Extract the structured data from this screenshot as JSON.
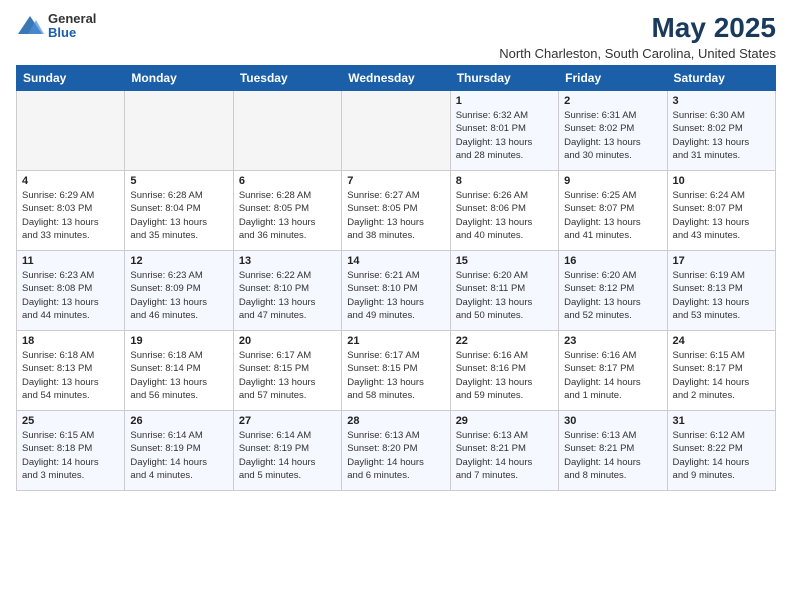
{
  "logo": {
    "general": "General",
    "blue": "Blue"
  },
  "header": {
    "title": "May 2025",
    "location": "North Charleston, South Carolina, United States"
  },
  "weekdays": [
    "Sunday",
    "Monday",
    "Tuesday",
    "Wednesday",
    "Thursday",
    "Friday",
    "Saturday"
  ],
  "weeks": [
    [
      {
        "day": "",
        "info": ""
      },
      {
        "day": "",
        "info": ""
      },
      {
        "day": "",
        "info": ""
      },
      {
        "day": "",
        "info": ""
      },
      {
        "day": "1",
        "info": "Sunrise: 6:32 AM\nSunset: 8:01 PM\nDaylight: 13 hours\nand 28 minutes."
      },
      {
        "day": "2",
        "info": "Sunrise: 6:31 AM\nSunset: 8:02 PM\nDaylight: 13 hours\nand 30 minutes."
      },
      {
        "day": "3",
        "info": "Sunrise: 6:30 AM\nSunset: 8:02 PM\nDaylight: 13 hours\nand 31 minutes."
      }
    ],
    [
      {
        "day": "4",
        "info": "Sunrise: 6:29 AM\nSunset: 8:03 PM\nDaylight: 13 hours\nand 33 minutes."
      },
      {
        "day": "5",
        "info": "Sunrise: 6:28 AM\nSunset: 8:04 PM\nDaylight: 13 hours\nand 35 minutes."
      },
      {
        "day": "6",
        "info": "Sunrise: 6:28 AM\nSunset: 8:05 PM\nDaylight: 13 hours\nand 36 minutes."
      },
      {
        "day": "7",
        "info": "Sunrise: 6:27 AM\nSunset: 8:05 PM\nDaylight: 13 hours\nand 38 minutes."
      },
      {
        "day": "8",
        "info": "Sunrise: 6:26 AM\nSunset: 8:06 PM\nDaylight: 13 hours\nand 40 minutes."
      },
      {
        "day": "9",
        "info": "Sunrise: 6:25 AM\nSunset: 8:07 PM\nDaylight: 13 hours\nand 41 minutes."
      },
      {
        "day": "10",
        "info": "Sunrise: 6:24 AM\nSunset: 8:07 PM\nDaylight: 13 hours\nand 43 minutes."
      }
    ],
    [
      {
        "day": "11",
        "info": "Sunrise: 6:23 AM\nSunset: 8:08 PM\nDaylight: 13 hours\nand 44 minutes."
      },
      {
        "day": "12",
        "info": "Sunrise: 6:23 AM\nSunset: 8:09 PM\nDaylight: 13 hours\nand 46 minutes."
      },
      {
        "day": "13",
        "info": "Sunrise: 6:22 AM\nSunset: 8:10 PM\nDaylight: 13 hours\nand 47 minutes."
      },
      {
        "day": "14",
        "info": "Sunrise: 6:21 AM\nSunset: 8:10 PM\nDaylight: 13 hours\nand 49 minutes."
      },
      {
        "day": "15",
        "info": "Sunrise: 6:20 AM\nSunset: 8:11 PM\nDaylight: 13 hours\nand 50 minutes."
      },
      {
        "day": "16",
        "info": "Sunrise: 6:20 AM\nSunset: 8:12 PM\nDaylight: 13 hours\nand 52 minutes."
      },
      {
        "day": "17",
        "info": "Sunrise: 6:19 AM\nSunset: 8:13 PM\nDaylight: 13 hours\nand 53 minutes."
      }
    ],
    [
      {
        "day": "18",
        "info": "Sunrise: 6:18 AM\nSunset: 8:13 PM\nDaylight: 13 hours\nand 54 minutes."
      },
      {
        "day": "19",
        "info": "Sunrise: 6:18 AM\nSunset: 8:14 PM\nDaylight: 13 hours\nand 56 minutes."
      },
      {
        "day": "20",
        "info": "Sunrise: 6:17 AM\nSunset: 8:15 PM\nDaylight: 13 hours\nand 57 minutes."
      },
      {
        "day": "21",
        "info": "Sunrise: 6:17 AM\nSunset: 8:15 PM\nDaylight: 13 hours\nand 58 minutes."
      },
      {
        "day": "22",
        "info": "Sunrise: 6:16 AM\nSunset: 8:16 PM\nDaylight: 13 hours\nand 59 minutes."
      },
      {
        "day": "23",
        "info": "Sunrise: 6:16 AM\nSunset: 8:17 PM\nDaylight: 14 hours\nand 1 minute."
      },
      {
        "day": "24",
        "info": "Sunrise: 6:15 AM\nSunset: 8:17 PM\nDaylight: 14 hours\nand 2 minutes."
      }
    ],
    [
      {
        "day": "25",
        "info": "Sunrise: 6:15 AM\nSunset: 8:18 PM\nDaylight: 14 hours\nand 3 minutes."
      },
      {
        "day": "26",
        "info": "Sunrise: 6:14 AM\nSunset: 8:19 PM\nDaylight: 14 hours\nand 4 minutes."
      },
      {
        "day": "27",
        "info": "Sunrise: 6:14 AM\nSunset: 8:19 PM\nDaylight: 14 hours\nand 5 minutes."
      },
      {
        "day": "28",
        "info": "Sunrise: 6:13 AM\nSunset: 8:20 PM\nDaylight: 14 hours\nand 6 minutes."
      },
      {
        "day": "29",
        "info": "Sunrise: 6:13 AM\nSunset: 8:21 PM\nDaylight: 14 hours\nand 7 minutes."
      },
      {
        "day": "30",
        "info": "Sunrise: 6:13 AM\nSunset: 8:21 PM\nDaylight: 14 hours\nand 8 minutes."
      },
      {
        "day": "31",
        "info": "Sunrise: 6:12 AM\nSunset: 8:22 PM\nDaylight: 14 hours\nand 9 minutes."
      }
    ]
  ]
}
